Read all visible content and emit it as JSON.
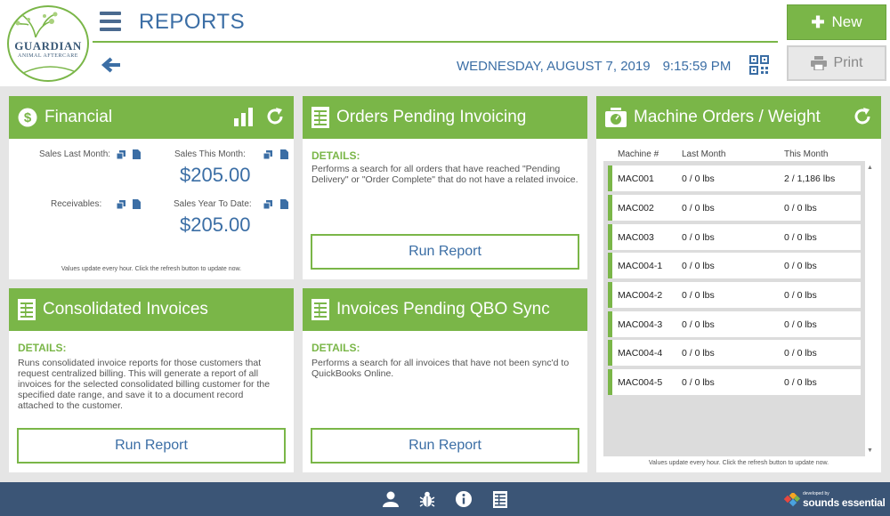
{
  "logo": {
    "name": "GUARDIAN",
    "tagline": "ANIMAL AFTERCARE"
  },
  "header": {
    "title": "REPORTS",
    "date": "WEDNESDAY, AUGUST 7, 2019",
    "time": "9:15:59 PM",
    "new_label": "New",
    "print_label": "Print"
  },
  "financial": {
    "title": "Financial",
    "sales_last_month_label": "Sales Last Month:",
    "sales_this_month_label": "Sales This Month:",
    "sales_this_month_value": "$205.00",
    "receivables_label": "Receivables:",
    "sales_ytd_label": "Sales Year To Date:",
    "sales_ytd_value": "$205.00",
    "note": "Values update every hour. Click the refresh button to update now."
  },
  "orders_pending": {
    "title": "Orders Pending Invoicing",
    "details_label": "DETAILS:",
    "details": "Performs a search for all orders that have reached \"Pending Delivery\" or \"Order Complete\" that do not have a related invoice.",
    "button": "Run Report"
  },
  "consolidated": {
    "title": "Consolidated Invoices",
    "details_label": "DETAILS:",
    "details": "Runs consolidated invoice reports for those customers that request centralized billing. This will generate a report of all invoices for the selected consolidated billing customer for the specified date range, and save it to a document record attached to the customer.",
    "button": "Run Report"
  },
  "qbo_sync": {
    "title": "Invoices Pending QBO Sync",
    "details_label": "DETAILS:",
    "details": "Performs a search for all invoices that have not been sync'd to QuickBooks Online.",
    "button": "Run Report"
  },
  "machine": {
    "title": "Machine Orders / Weight",
    "columns": [
      "Machine #",
      "Last Month",
      "This Month"
    ],
    "rows": [
      [
        "MAC001",
        "0 / 0 lbs",
        "2 / 1,186 lbs"
      ],
      [
        "MAC002",
        "0 / 0 lbs",
        "0 / 0 lbs"
      ],
      [
        "MAC003",
        "0 / 0 lbs",
        "0 / 0 lbs"
      ],
      [
        "MAC004-1",
        "0 / 0 lbs",
        "0 / 0 lbs"
      ],
      [
        "MAC004-2",
        "0 / 0 lbs",
        "0 / 0 lbs"
      ],
      [
        "MAC004-3",
        "0 / 0 lbs",
        "0 / 0 lbs"
      ],
      [
        "MAC004-4",
        "0 / 0 lbs",
        "0 / 0 lbs"
      ],
      [
        "MAC004-5",
        "0 / 0 lbs",
        "0 / 0 lbs"
      ]
    ],
    "note": "Values update every hour. Click the refresh button to update now."
  },
  "footer": {
    "brand_small": "developed by",
    "brand_name": "sounds essential"
  },
  "colors": {
    "accent_green": "#7ab648",
    "brand_blue": "#3b6ea5",
    "footer_navy": "#3b5576"
  }
}
